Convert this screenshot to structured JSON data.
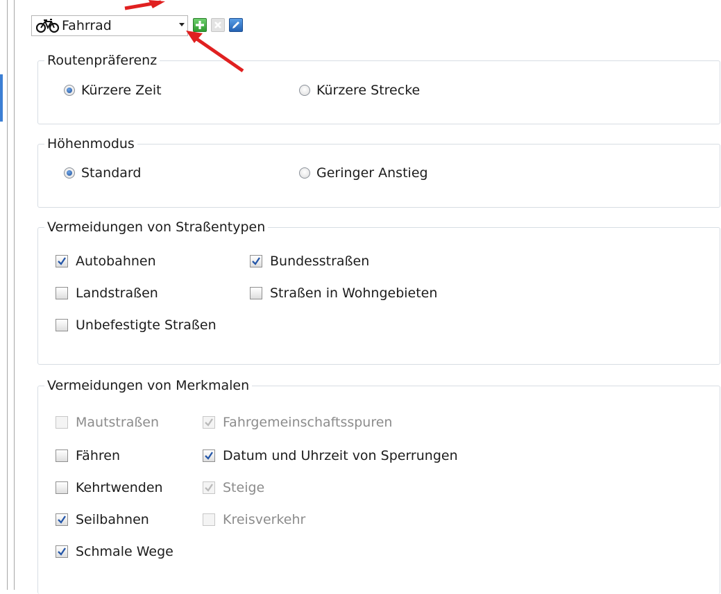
{
  "profile": {
    "selected": "Fahrrad",
    "icon": "bicycle-icon",
    "buttons": [
      {
        "name": "add-profile-button",
        "icon": "plus-icon",
        "color": "#3aa53a"
      },
      {
        "name": "delete-profile-button",
        "icon": "close-icon",
        "color": "#c8c8c8",
        "disabled": true
      },
      {
        "name": "edit-profile-button",
        "icon": "pencil-icon",
        "color": "#2f6fc2"
      }
    ]
  },
  "route_preference": {
    "legend": "Routenpräferenz",
    "options": [
      {
        "label": "Kürzere Zeit",
        "selected": true
      },
      {
        "label": "Kürzere Strecke",
        "selected": false
      }
    ]
  },
  "elevation_mode": {
    "legend": "Höhenmodus",
    "options": [
      {
        "label": "Standard",
        "selected": true
      },
      {
        "label": "Geringer Anstieg",
        "selected": false
      }
    ]
  },
  "road_avoidances": {
    "legend": "Vermeidungen von Straßentypen",
    "items": [
      {
        "label": "Autobahnen",
        "checked": true
      },
      {
        "label": "Bundesstraßen",
        "checked": true
      },
      {
        "label": "Landstraßen",
        "checked": false
      },
      {
        "label": "Straßen in Wohngebieten",
        "checked": false
      },
      {
        "label": "Unbefestigte Straßen",
        "checked": false
      }
    ]
  },
  "feature_avoidances": {
    "legend": "Vermeidungen von Merkmalen",
    "items": [
      {
        "label": "Mautstraßen",
        "checked": false,
        "disabled": true
      },
      {
        "label": "Fahrgemeinschaftsspuren",
        "checked": true,
        "disabled": true
      },
      {
        "label": "Fähren",
        "checked": false
      },
      {
        "label": "Datum und Uhrzeit von Sperrungen",
        "checked": true
      },
      {
        "label": "Kehrtwenden",
        "checked": false
      },
      {
        "label": "Steige",
        "checked": true,
        "disabled": true
      },
      {
        "label": "Seilbahnen",
        "checked": true
      },
      {
        "label": "Kreisverkehr",
        "checked": false,
        "disabled": true
      },
      {
        "label": "Schmale Wege",
        "checked": true
      }
    ]
  },
  "colors": {
    "accent": "#3c7fd4",
    "annotation_arrow": "#e02020",
    "check": "#2456a8",
    "disabled_text": "#8c8c8c"
  }
}
